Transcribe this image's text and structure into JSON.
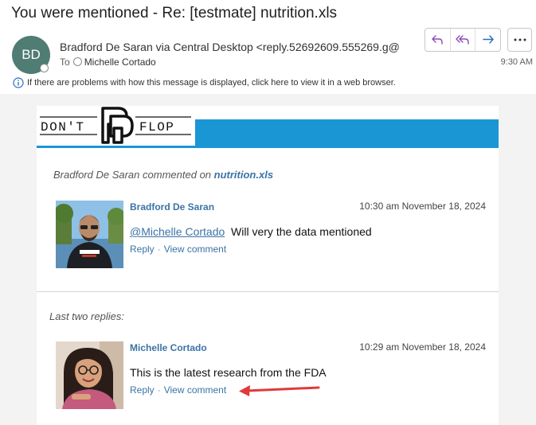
{
  "header": {
    "subject": "You were mentioned - Re: [testmate] nutrition.xls",
    "avatar_initials": "BD",
    "sender": "Bradford De Saran via Central Desktop <reply.52692609.555269.g@",
    "to_label": "To",
    "to_name": "Michelle Cortado",
    "time": "9:30 AM",
    "info_text": "If there are problems with how this message is displayed, click here to view it in a web browser."
  },
  "actions": {
    "reply_icon": "reply-icon",
    "reply_all_icon": "reply-all-icon",
    "forward_icon": "forward-icon",
    "more_icon": "more-icon"
  },
  "logo": {
    "left_text": "DON'T",
    "right_text": "FLOP",
    "accent_color": "#1a96d4"
  },
  "email": {
    "activity_actor": "Bradford De Saran",
    "activity_verb": "commented on",
    "file_name": "nutrition.xls",
    "comment": {
      "author": "Bradford De Saran",
      "timestamp": "10:30 am November 18, 2024",
      "mention": "@Michelle Cortado",
      "text": "Will very the data mentioned",
      "reply_label": "Reply",
      "view_label": "View comment"
    },
    "last_replies_label": "Last two replies:",
    "reply": {
      "author": "Michelle Cortado",
      "timestamp": "10:29 am November 18, 2024",
      "text": "This is the latest research from the FDA",
      "reply_label": "Reply",
      "view_label": "View comment"
    }
  },
  "colors": {
    "link": "#3b73a6",
    "avatar_bg": "#4f7c73",
    "annotation_arrow": "#e03a3a"
  }
}
